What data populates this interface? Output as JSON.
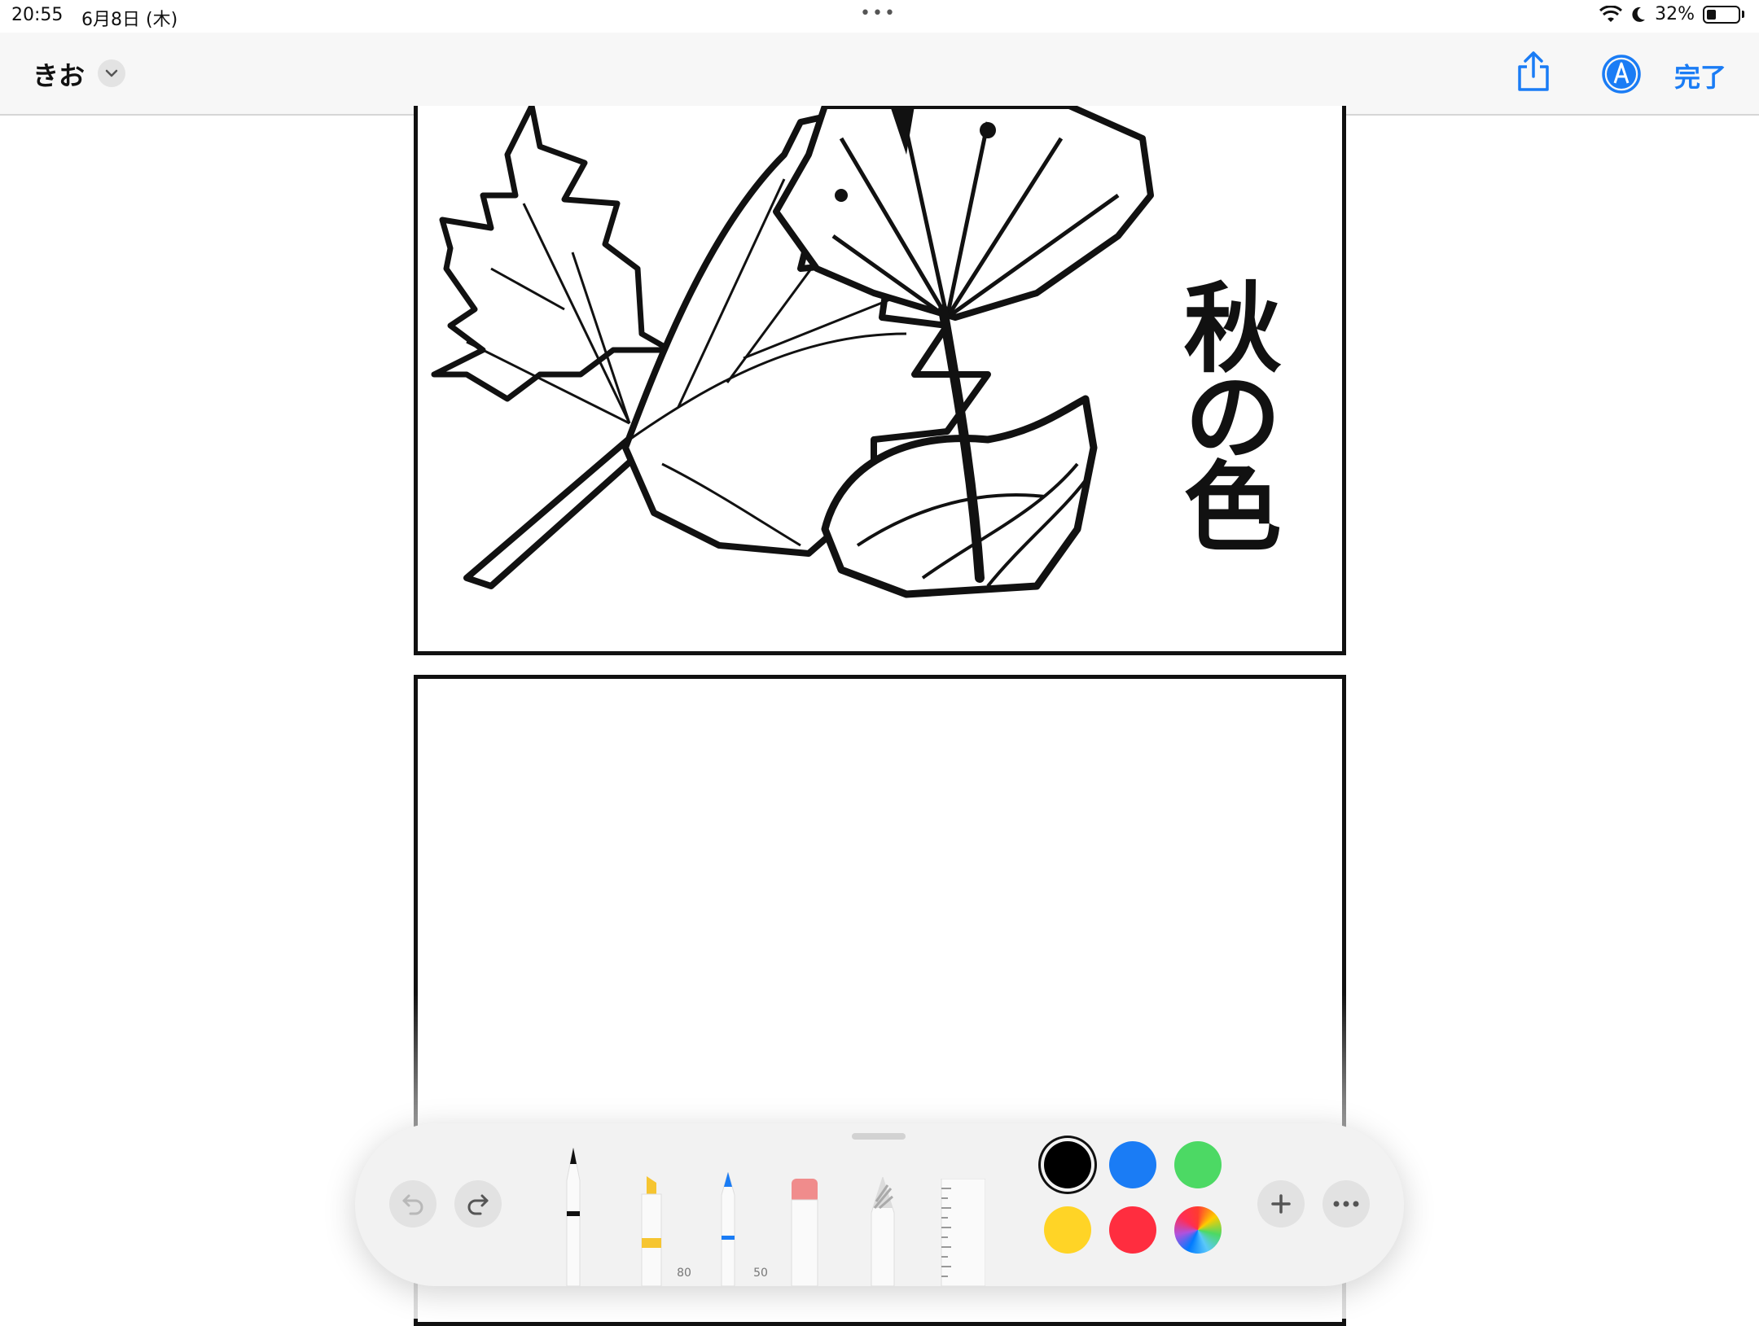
{
  "status_bar": {
    "time": "20:55",
    "date": "6月8日 (木)",
    "battery": "32%",
    "battery_level": 0.32
  },
  "nav": {
    "title": "きお",
    "done_label": "完了",
    "accent_color": "#1a7cf5"
  },
  "artwork": {
    "text": "秋の色"
  },
  "toolbar": {
    "tools": [
      {
        "name": "pen",
        "label": ""
      },
      {
        "name": "highlighter",
        "label": "80"
      },
      {
        "name": "pencil",
        "label": "50"
      },
      {
        "name": "eraser",
        "label": ""
      },
      {
        "name": "lasso",
        "label": ""
      },
      {
        "name": "ruler",
        "label": ""
      }
    ],
    "colors": [
      "#000000",
      "#1a7cf5",
      "#4cd964",
      "#ffd426",
      "#ff2d3f",
      "color-wheel"
    ],
    "selected_color": "#000000"
  }
}
